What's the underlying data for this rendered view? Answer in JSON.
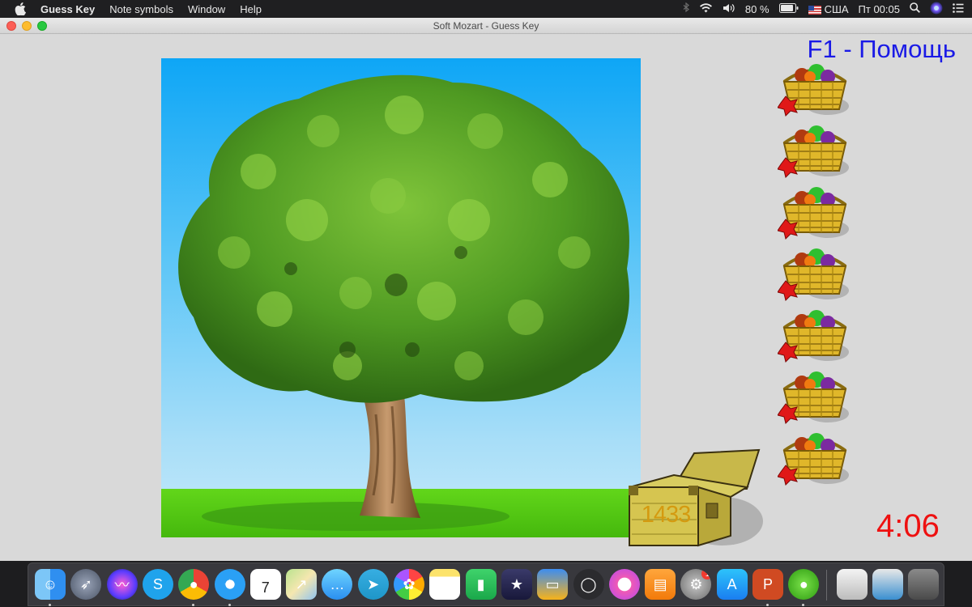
{
  "menubar": {
    "app_name": "Guess Key",
    "items": [
      "Note symbols",
      "Window",
      "Help"
    ],
    "battery": "80 %",
    "input_source": "США",
    "clock": "Пт 00:05"
  },
  "window": {
    "title": "Soft Mozart - Guess Key"
  },
  "game": {
    "help_text": "F1 - Помощь",
    "baskets_count": 7,
    "chest_score": "1433",
    "timer": "4:06"
  },
  "dock": {
    "apps": [
      {
        "name": "finder-icon",
        "running": true
      },
      {
        "name": "launchpad-icon",
        "running": false
      },
      {
        "name": "siri-icon",
        "running": false
      },
      {
        "name": "skype-icon",
        "running": false
      },
      {
        "name": "chrome-icon",
        "running": true
      },
      {
        "name": "safari-icon",
        "running": true
      },
      {
        "name": "calendar-icon",
        "running": false,
        "label": "7"
      },
      {
        "name": "maps-icon",
        "running": false
      },
      {
        "name": "messages-icon",
        "running": false
      },
      {
        "name": "telegram-icon",
        "running": false
      },
      {
        "name": "photos-icon",
        "running": false
      },
      {
        "name": "notes-icon",
        "running": false
      },
      {
        "name": "numbers-icon",
        "running": false
      },
      {
        "name": "imovie-icon",
        "running": false
      },
      {
        "name": "keynote-icon",
        "running": false
      },
      {
        "name": "screen-record-icon",
        "running": false
      },
      {
        "name": "itunes-icon",
        "running": false
      },
      {
        "name": "books-icon",
        "running": false
      },
      {
        "name": "system-preferences-icon",
        "running": false,
        "badge": "1"
      },
      {
        "name": "app-store-icon",
        "running": false
      },
      {
        "name": "powerpoint-icon",
        "running": true
      },
      {
        "name": "soft-mozart-icon",
        "running": true
      }
    ]
  }
}
